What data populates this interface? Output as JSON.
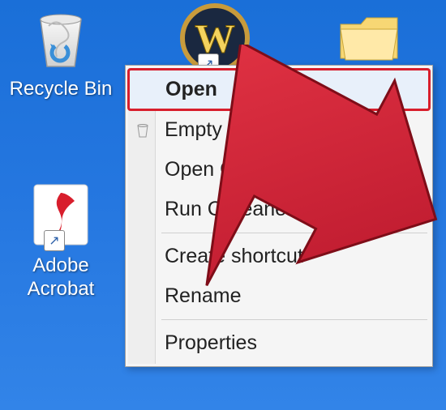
{
  "desktop": {
    "icons": {
      "recycle": {
        "label": "Recycle Bin"
      },
      "wow": {
        "label": ""
      },
      "folder": {
        "label": ""
      },
      "adobe": {
        "label": "Adobe Acrobat"
      }
    }
  },
  "contextMenu": {
    "items": [
      {
        "label": "Open",
        "bold": true,
        "highlighted": true,
        "boxed": true
      },
      {
        "label": "Empty Recycle Bin",
        "icon": "recycle-small"
      },
      {
        "label": "Open CCleaner..."
      },
      {
        "label": "Run CCleaner"
      },
      {
        "separator": true
      },
      {
        "label": "Create shortcut"
      },
      {
        "label": "Rename"
      },
      {
        "separator": true
      },
      {
        "label": "Properties"
      }
    ]
  },
  "annotation": {
    "arrowColor": "#d81e2c",
    "boxColor": "#d81e2c"
  }
}
